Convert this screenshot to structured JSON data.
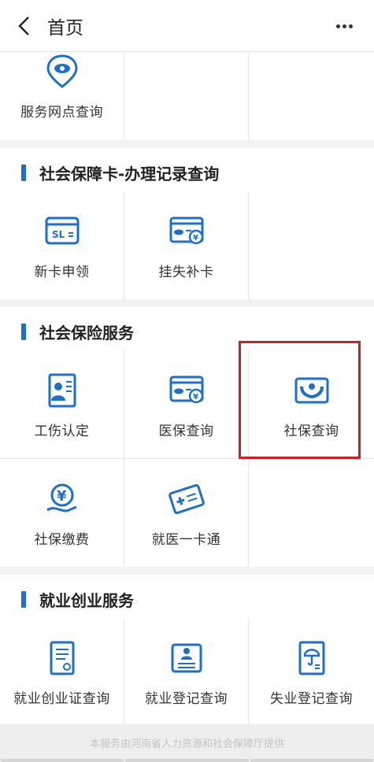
{
  "header": {
    "title": "首页",
    "back_icon": "back-arrow-icon",
    "menu_icon": "more-dots-icon"
  },
  "top_partial": {
    "items": [
      {
        "label": "服务网点查询",
        "icon": "location-eye-icon"
      }
    ]
  },
  "sections": [
    {
      "title": "社会保障卡-办理记录查询",
      "items": [
        {
          "label": "新卡申领",
          "icon": "sl-card-icon"
        },
        {
          "label": "挂失补卡",
          "icon": "card-yuan-icon"
        }
      ]
    },
    {
      "title": "社会保险服务",
      "items": [
        {
          "label": "工伤认定",
          "icon": "injury-doc-icon"
        },
        {
          "label": "医保查询",
          "icon": "card-yuan-icon"
        },
        {
          "label": "社保查询",
          "icon": "hands-protect-icon"
        },
        {
          "label": "社保缴费",
          "icon": "yuan-hand-icon"
        },
        {
          "label": "就医一卡通",
          "icon": "medical-card-icon"
        }
      ]
    },
    {
      "title": "就业创业服务",
      "items": [
        {
          "label": "就业创业证查询",
          "icon": "certificate-icon"
        },
        {
          "label": "就业登记查询",
          "icon": "register-icon"
        },
        {
          "label": "失业登记查询",
          "icon": "umbrella-doc-icon"
        }
      ]
    }
  ],
  "footer": {
    "text": "本服务由河南省人力资源和社会保障厅提供"
  },
  "colors": {
    "accent": "#1e6fc8",
    "highlight": "#cc1f25"
  }
}
